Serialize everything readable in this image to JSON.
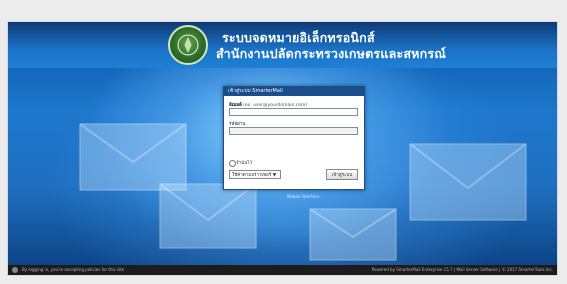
{
  "header": {
    "line1": "ระบบจดหมายอิเล็กทรอนิกส์",
    "line2": "สำนักงานปลัดกระทรวงเกษตรและสหกรณ์"
  },
  "login": {
    "title": "เข้าสู่ระบบ SmarterMail",
    "email_label": "อีเมลล์",
    "email_hint": "(ex. user@yourdomain.com)",
    "email_value": "",
    "password_label": "รหัสผ่าน",
    "password_value": "",
    "remember_label": "จำฉันไว้",
    "language_selected": "ใช้ค่าตามบราวเซอร์",
    "submit_label": "เข้าสู่ระบบ"
  },
  "below_box": "Mobile Interface",
  "footer": {
    "left": "By logging in, you're accepting policies for this site",
    "right": "Powered by SmarterMail Enterprise 15.7 | Mail Server Software | © 2017 SmarterTools Inc."
  },
  "colors": {
    "header_bg": "#1b73c6",
    "box_header": "#1a4d8c",
    "footer_bg": "#1c1c1c"
  },
  "icons": {
    "logo": "ministry-emblem",
    "footer": "info-icon"
  }
}
